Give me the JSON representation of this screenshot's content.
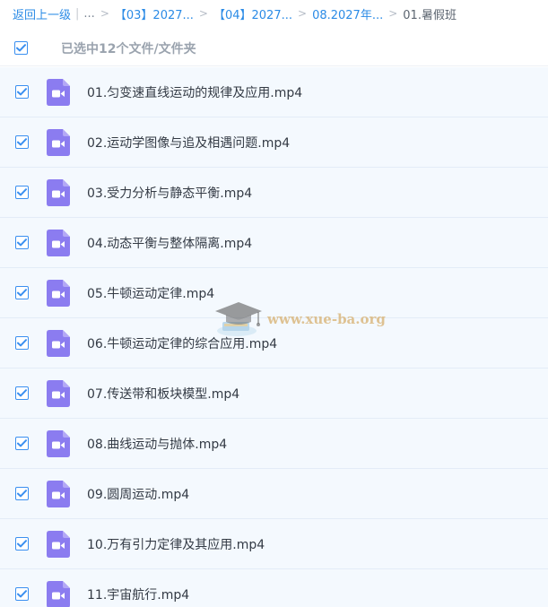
{
  "breadcrumb": {
    "back_label": "返回上一级",
    "pipe": "|",
    "ellipsis": "...",
    "separator": ">",
    "crumbs": [
      "【03】2027...",
      "【04】2027...",
      "08.2027年..."
    ],
    "current": "01.暑假班"
  },
  "selection": {
    "summary": "已选中12个文件/文件夹",
    "all_checked": true
  },
  "files": [
    {
      "name": "01.匀变速直线运动的规律及应用.mp4",
      "checked": true
    },
    {
      "name": "02.运动学图像与追及相遇问题.mp4",
      "checked": true
    },
    {
      "name": "03.受力分析与静态平衡.mp4",
      "checked": true
    },
    {
      "name": "04.动态平衡与整体隔离.mp4",
      "checked": true
    },
    {
      "name": "05.牛顿运动定律.mp4",
      "checked": true
    },
    {
      "name": "06.牛顿运动定律的综合应用.mp4",
      "checked": true
    },
    {
      "name": "07.传送带和板块模型.mp4",
      "checked": true
    },
    {
      "name": "08.曲线运动与抛体.mp4",
      "checked": true
    },
    {
      "name": "09.圆周运动.mp4",
      "checked": true
    },
    {
      "name": "10.万有引力定律及其应用.mp4",
      "checked": true
    },
    {
      "name": "11.宇宙航行.mp4",
      "checked": true
    }
  ],
  "watermark": {
    "text": "www.xue-ba.org",
    "icon": "graduation-cap-icon"
  },
  "colors": {
    "accent": "#2b8be6",
    "row_bg": "#f4f9fe",
    "video_icon": "#8b7cf0",
    "checkbox": "#3a8ff0"
  },
  "icons": {
    "file": "video-file-icon",
    "check": "checkmark-icon"
  }
}
